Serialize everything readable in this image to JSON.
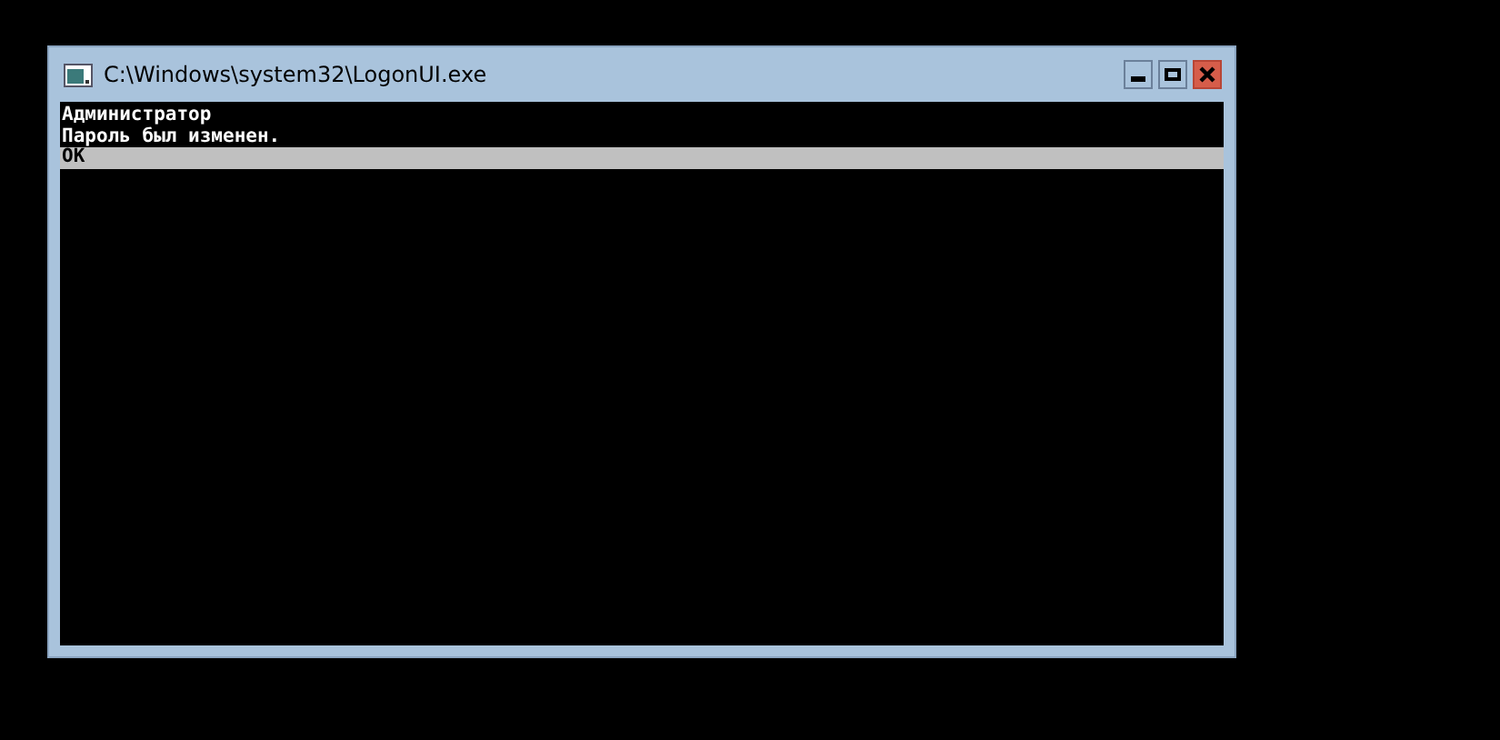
{
  "window": {
    "title": "C:\\Windows\\system32\\LogonUI.exe"
  },
  "console": {
    "lines": [
      {
        "text": "Администратор",
        "selected": false
      },
      {
        "text": "Пароль был изменен.",
        "selected": false
      },
      {
        "text": "OK",
        "selected": true
      }
    ]
  }
}
